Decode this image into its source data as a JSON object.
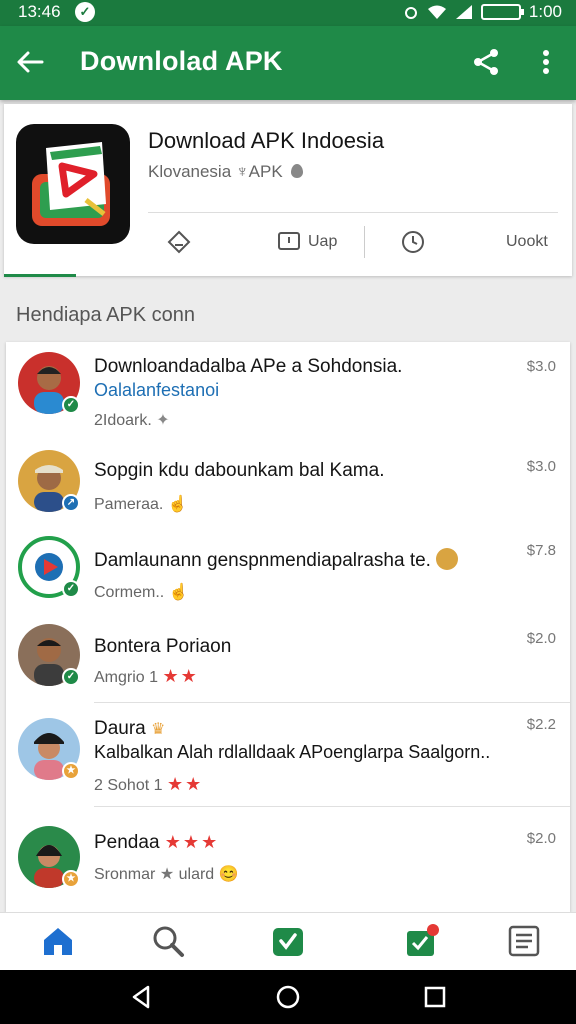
{
  "status_bar": {
    "time": "13:46",
    "right_time": "1:00"
  },
  "app_bar": {
    "title": "Downlolad APK"
  },
  "app_header": {
    "name": "Download APK Indoesia",
    "subtitle": "Klovanesia ♆APK",
    "actions": [
      {
        "label": "",
        "icon": "install-icon"
      },
      {
        "label": "Uap",
        "icon": "bookmark-icon"
      },
      {
        "label": "",
        "icon": "clock-icon"
      },
      {
        "label": "Uookt",
        "icon": ""
      }
    ]
  },
  "section_title": "Hendiapa APK conn",
  "list": [
    {
      "title": "Downloandadalba APe a Sohdonsia.",
      "link": "Oalalanfestanoi",
      "meta": "2Idoark.",
      "price": "$3.0"
    },
    {
      "title": "Sopgin kdu dabounkam bal Kama.",
      "meta": "Pameraa.",
      "price": "$3.0"
    },
    {
      "title": "Damlaunann genspnmendiapalrasha te.",
      "meta": "Cormem..",
      "price": "$7.8"
    },
    {
      "title": "Bontera Poriaon",
      "meta": "Amgrio 1",
      "stars": "★★",
      "price": "$2.0"
    },
    {
      "title": "Daura",
      "body": "Kalbalkan Alah rdlalldaak APoenglarpa Saalgorn..",
      "meta": "2 Sohot 1",
      "stars": "★★",
      "price": "$2.2"
    },
    {
      "title": "Pendaa",
      "title_stars": "★★★",
      "meta": "Sronmar",
      "extra": "ulard",
      "price": "$2.0"
    }
  ],
  "colors": {
    "primary": "#1f8a48",
    "status": "#1b7a3e",
    "accent_red": "#e53935",
    "link_blue": "#1e6fb4"
  }
}
